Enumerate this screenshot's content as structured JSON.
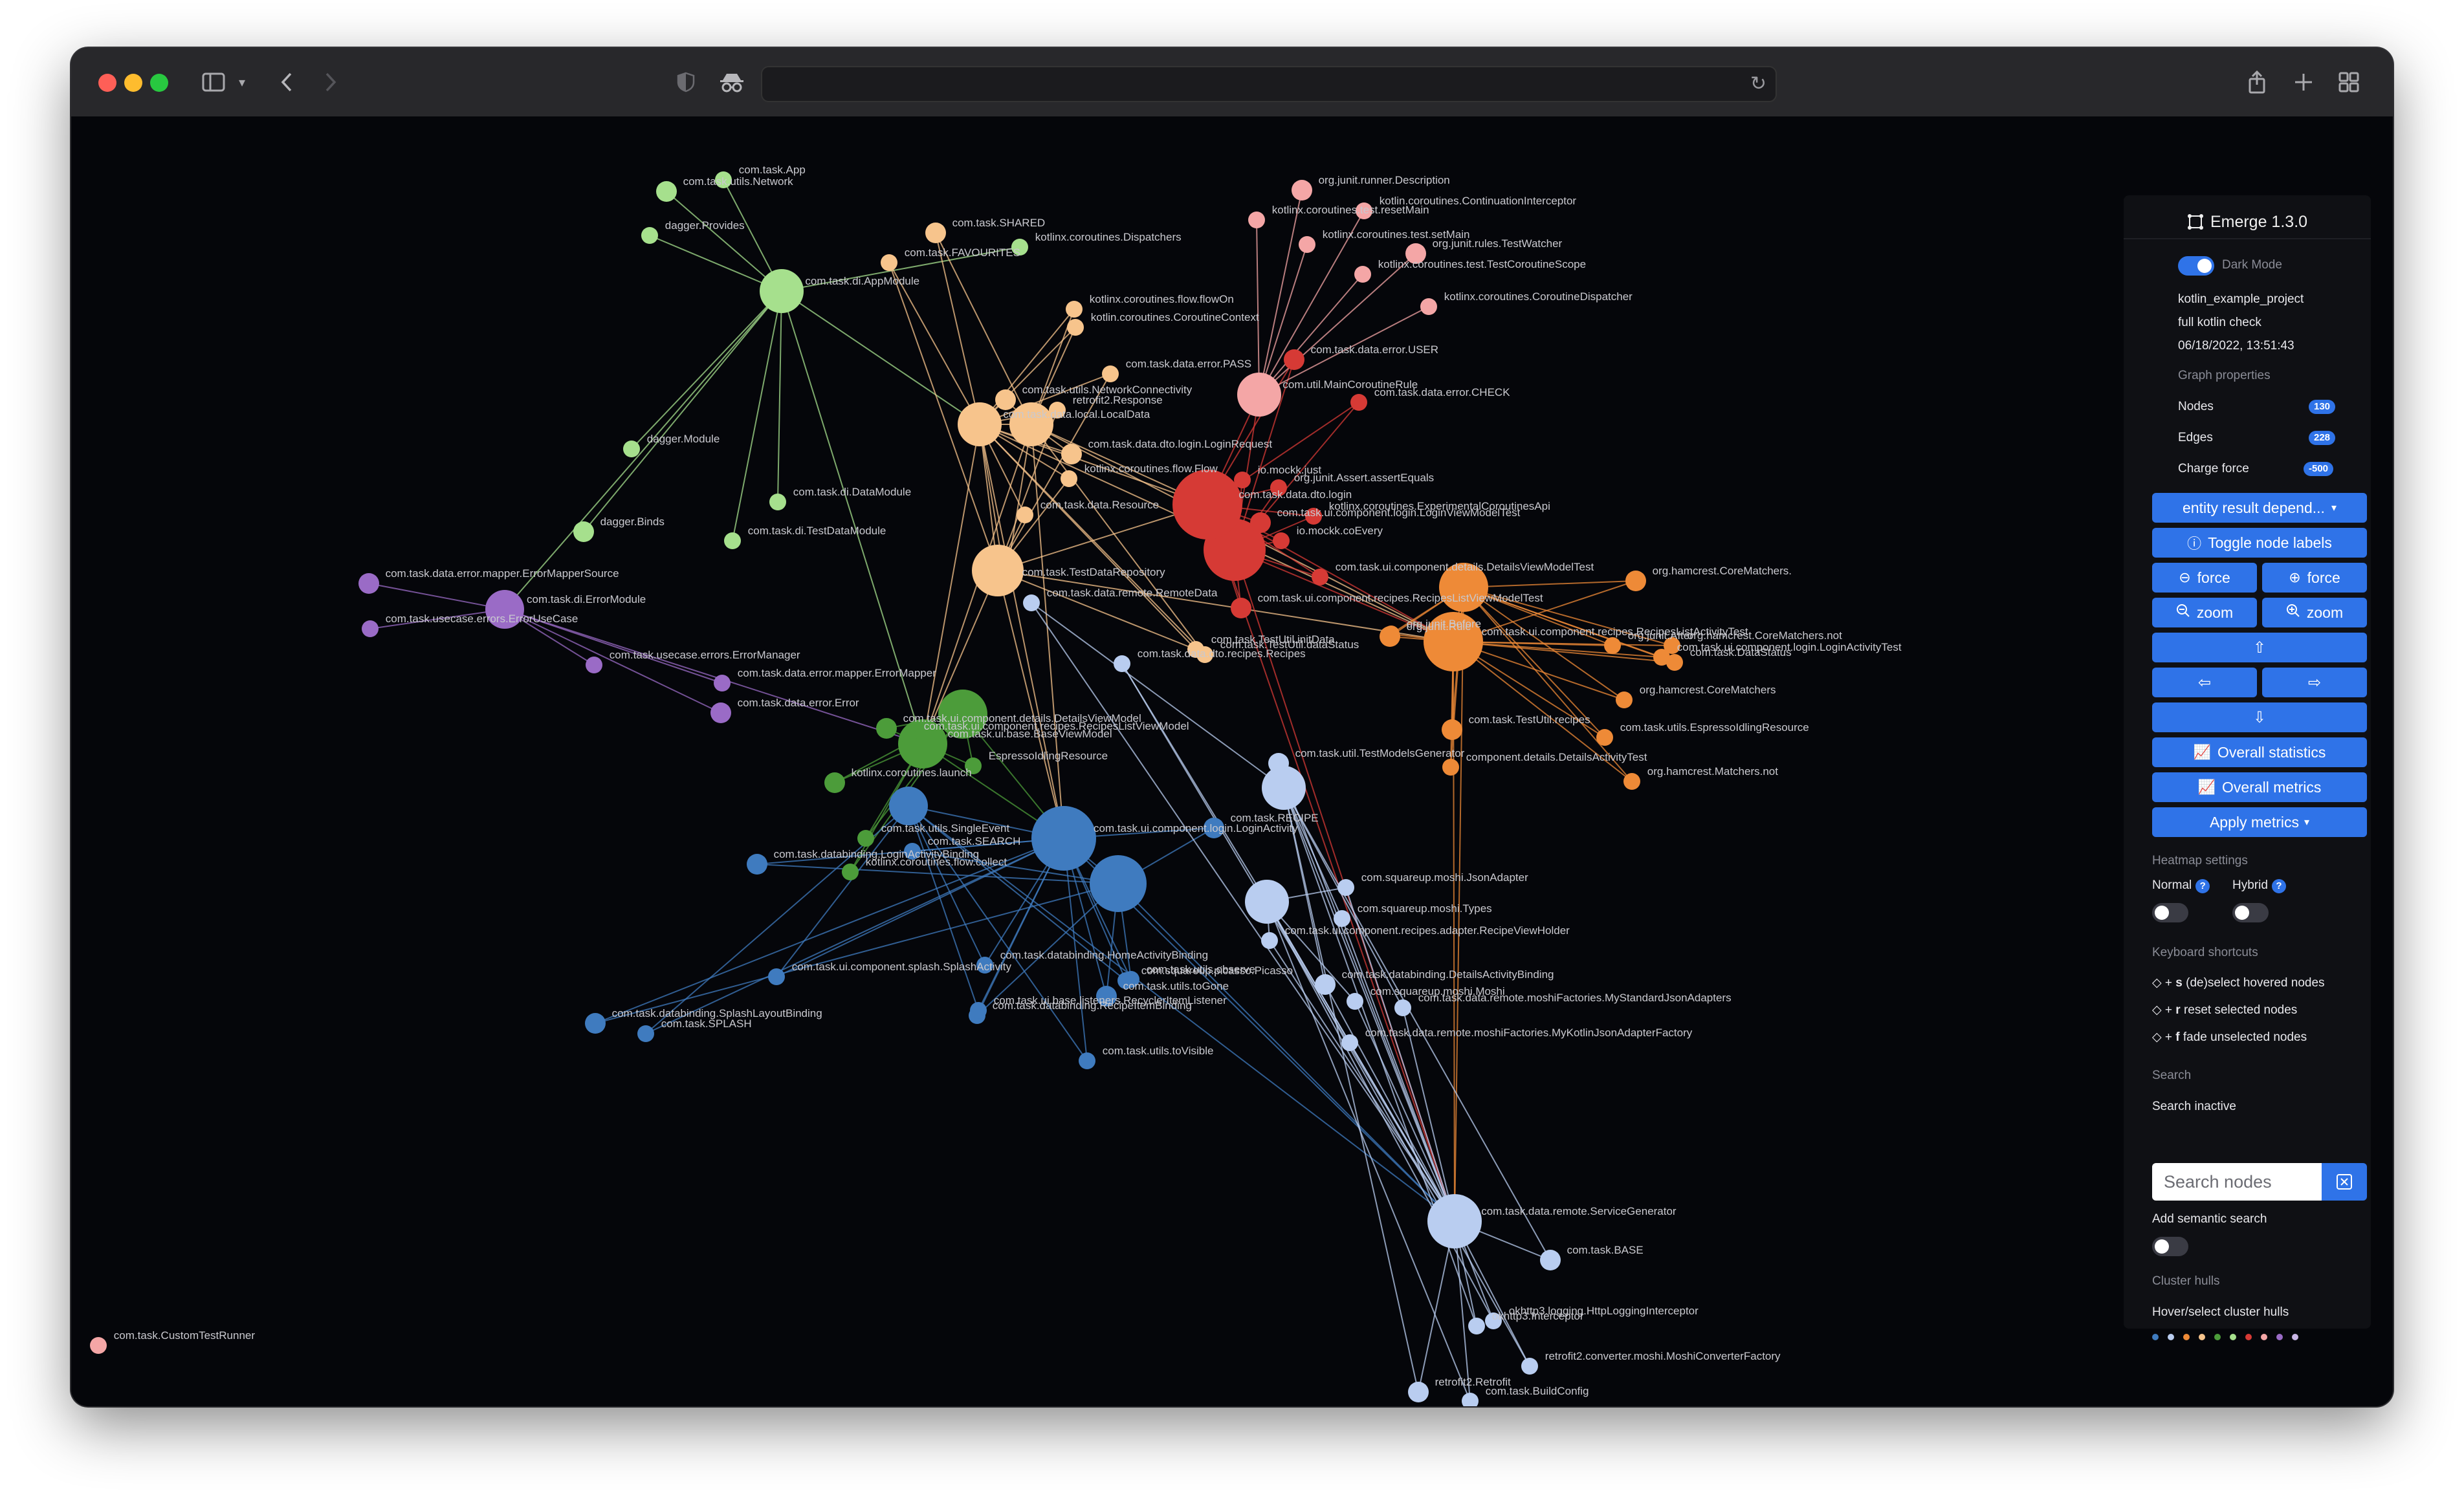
{
  "app": {
    "name": "Emerge 1.3.0"
  },
  "settings": {
    "dark_mode_label": "Dark Mode",
    "project_name": "kotlin_example_project",
    "analysis_name": "full kotlin check",
    "timestamp": "06/18/2022, 13:51:43"
  },
  "graph_properties": {
    "heading": "Graph properties",
    "nodes_label": "Nodes",
    "nodes_value": "130",
    "edges_label": "Edges",
    "edges_value": "228",
    "charge_label": "Charge force",
    "charge_value": "-500"
  },
  "controls": {
    "graph_select": "entity result depend...",
    "toggle_labels": "Toggle node labels",
    "force_minus": "force",
    "force_plus": "force",
    "zoom_minus": "zoom",
    "zoom_plus": "zoom",
    "overall_statistics": "Overall statistics",
    "overall_metrics": "Overall metrics",
    "apply_metrics": "Apply metrics"
  },
  "heatmap": {
    "heading": "Heatmap settings",
    "normal_label": "Normal",
    "hybrid_label": "Hybrid",
    "help": "?"
  },
  "shortcuts": {
    "heading": "Keyboard shortcuts",
    "items": [
      {
        "key": "s",
        "text": "(de)select hovered nodes"
      },
      {
        "key": "r",
        "text": "reset selected nodes"
      },
      {
        "key": "f",
        "text": "fade unselected nodes"
      }
    ],
    "plus": "+"
  },
  "search": {
    "heading": "Search",
    "status": "Search inactive",
    "placeholder": "Search nodes",
    "semantic_label": "Add semantic search"
  },
  "cluster": {
    "heading": "Cluster hulls",
    "hover_label": "Hover/select cluster hulls",
    "colors": [
      "#3f7bbf",
      "#b9cdf0",
      "#ee8a37",
      "#f7c48c",
      "#4c9c3a",
      "#a6e08d",
      "#d63a35",
      "#f4a6a6",
      "#9a6bc6",
      "#c9b6e6"
    ]
  },
  "graph": {
    "clusters": [
      {
        "id": "lightgreen",
        "color": "#a6e08d",
        "edge_color": "#a6e08d",
        "hub": "com.task.di.AppModule",
        "nodes": [
          "com.task.utils.Network",
          "com.task.App",
          "dagger.Provides",
          "dagger.Module",
          "dagger.Binds",
          "com.task.di.DataModule",
          "com.task.di.TestDataModule",
          "kotlinx.coroutines.Dispatchers"
        ]
      },
      {
        "id": "peach",
        "color": "#f7c48c",
        "edge_color": "#f7c48c",
        "hub": "com.task.data.local.LocalData",
        "nodes": [
          "com.task.SHARED",
          "com.task.FAVOURITES",
          "kotlin.coroutines.CoroutineContext",
          "com.task.data.error.PASS",
          "com.task.data.dto.login.LoginRequest",
          "kotlinx.coroutines.flow.Flow",
          "kotlinx.coroutines.flow.flowOn",
          "retrofit2.Response",
          "com.task.TestDataRepository",
          "com.task.data.Resource",
          "com.task.TestUtil.dataStatus",
          "com.task.TestUtil.initData",
          "com.task.utils.NetworkConnectivity"
        ]
      },
      {
        "id": "red",
        "color": "#d63a35",
        "edge_color": "#d63a35",
        "hub": "com.task.data.dto.login",
        "nodes": [
          "com.task.data.error.USER",
          "com.task.data.error.CHECK",
          "io.mockk.just",
          "org.junit.Assert.assertEquals",
          "com.task.ui.component.login.LoginViewModelTest",
          "kotlinx.coroutines.ExperimentalCoroutinesApi",
          "io.mockk.coEvery",
          "com.task.ui.component.details.DetailsViewModelTest",
          "com.task.ui.component.recipes.RecipesListViewModelTest"
        ]
      },
      {
        "id": "pink",
        "color": "#f4a6a6",
        "edge_color": "#f4a6a6",
        "hub": "com.util.MainCoroutineRule",
        "nodes": [
          "org.junit.runner.Description",
          "kotlin.coroutines.ContinuationInterceptor",
          "kotlinx.coroutines.test.resetMain",
          "kotlinx.coroutines.test.setMain",
          "org.junit.rules.TestWatcher",
          "kotlinx.coroutines.test.TestCoroutineScope",
          "kotlinx.coroutines.CoroutineDispatcher",
          "com.task.CustomTestRunner"
        ]
      },
      {
        "id": "orange",
        "color": "#ee8a37",
        "edge_color": "#ee8a37",
        "hub": "com.task.ui.component.recipes.RecipesListActivityTest",
        "nodes": [
          "org.hamcrest.CoreMatchers.",
          "org.hamcrest.CoreMatchers.not",
          "com.task.ui.component.login.LoginActivityTest",
          "org.junit.Before",
          "org.junit.Rule",
          "org.junit.After",
          "com.task.DataStatus",
          "component.details.DetailsActivityTest",
          "com.task.TestUtil.recipes",
          "org.hamcrest.CoreMatchers",
          "com.task.utils.EspressoIdlingResource",
          "org.hamcrest.Matchers.not"
        ]
      },
      {
        "id": "purple",
        "color": "#9a6bc6",
        "edge_color": "#9a6bc6",
        "hub": "com.task.di.ErrorModule",
        "nodes": [
          "com.task.data.error.mapper.ErrorMapperSource",
          "com.task.usecase.errors.ErrorUseCase",
          "com.task.usecase.errors.ErrorManager",
          "com.task.data.error.mapper.ErrorMapper",
          "com.task.data.error.Error"
        ]
      },
      {
        "id": "green",
        "color": "#4c9c3a",
        "edge_color": "#4c9c3a",
        "hub": "com.task.ui.base.BaseViewModel",
        "nodes": [
          "kotlinx.coroutines.launch",
          "kotlinx.coroutines.flow.collect",
          "com.task.utils.SingleEvent",
          "EspressoIdlingResource",
          "com.task.ui.component.details.DetailsViewModel",
          "com.task.ui.component.recipes.RecipesListViewModel"
        ]
      },
      {
        "id": "blue",
        "color": "#3f7bbf",
        "edge_color": "#3f7bbf",
        "hub": "com.task.ui.component.login.LoginActivity",
        "nodes": [
          "com.task.databinding.LoginActivityBinding",
          "com.task.ui.component.splash.SplashActivity",
          "com.task.SEARCH",
          "com.task.databinding.HomeActivityBinding",
          "com.task.databinding.SplashLayoutBinding",
          "com.task.SPLASH",
          "com.task.databinding.RecipeItemBinding",
          "com.task.ui.base.listeners.RecyclerItemListener",
          "com.task.utils.toGone",
          "com.task.utils.toVisible",
          "com.task.utils.observe",
          "com.squareup.picasso.Picasso",
          "com.task.RECIPE"
        ]
      },
      {
        "id": "lightblue",
        "color": "#b9cdf0",
        "edge_color": "#b9cdf0",
        "hub": "com.task.data.remote.ServiceGenerator",
        "nodes": [
          "com.task.util.TestModelsGenerator",
          "com.squareup.moshi.JsonAdapter",
          "com.squareup.moshi.Types",
          "com.task.ui.component.recipes.adapter.RecipeViewHolder",
          "com.task.databinding.DetailsActivityBinding",
          "com.squareup.moshi.Moshi",
          "com.task.data.remote.moshiFactories.MyStandardJsonAdapters",
          "com.task.data.remote.moshiFactories.MyKotlinJsonAdapterFactory",
          "com.task.BASE",
          "okhttp3.logging.HttpLoggingInterceptor",
          "okhttp3.Interceptor",
          "retrofit2.converter.moshi.MoshiConverterFactory",
          "retrofit2.Retrofit",
          "com.task.BuildConfig",
          "com.task.data.remote.RemoteData",
          "com.task.data.dto.recipes.Recipes"
        ]
      }
    ]
  }
}
